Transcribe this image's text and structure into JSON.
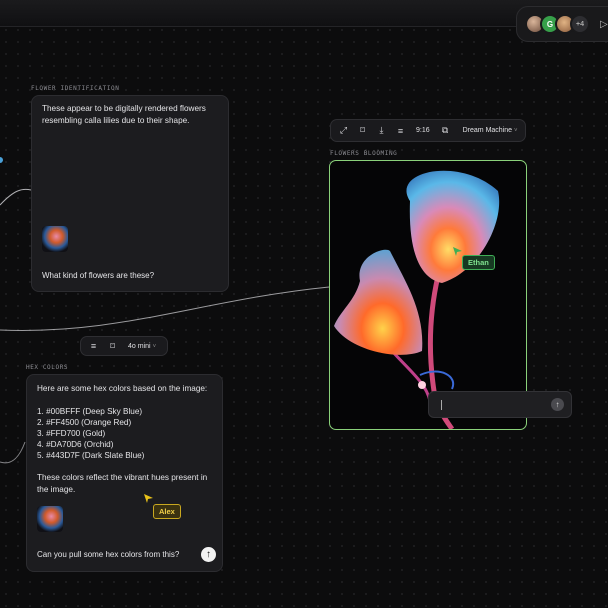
{
  "presence": {
    "avatars": [
      "",
      "G",
      "",
      "+4"
    ]
  },
  "flower_card": {
    "label": "FLOWER IDENTIFICATION",
    "response": "These appear to be digitally rendered flowers resembling calla lilies due to their shape.",
    "prompt": "What kind of flowers are these?"
  },
  "image_toolbar": {
    "ratio": "9:16",
    "model": "Dream Machine"
  },
  "image_node": {
    "label": "FLOWERS BLOOMING",
    "cursor_name": "Ethan",
    "cursor_color": "#3fae55"
  },
  "node_toolbar": {
    "model": "4o mini"
  },
  "hex_card": {
    "label": "HEX COLORS",
    "intro": "Here are some hex colors based on the image:",
    "colors": [
      "1. #00BFFF (Deep Sky Blue)",
      "2. #FF4500 (Orange Red)",
      "3. #FFD700 (Gold)",
      "4. #DA70D6 (Orchid)",
      "5. #443D7F (Dark Slate Blue)"
    ],
    "outro": "These colors reflect the vibrant hues present in the image.",
    "prompt": "Can you pull some hex colors from this?",
    "cursor_name": "Alex",
    "cursor_color": "#e9c21a"
  }
}
